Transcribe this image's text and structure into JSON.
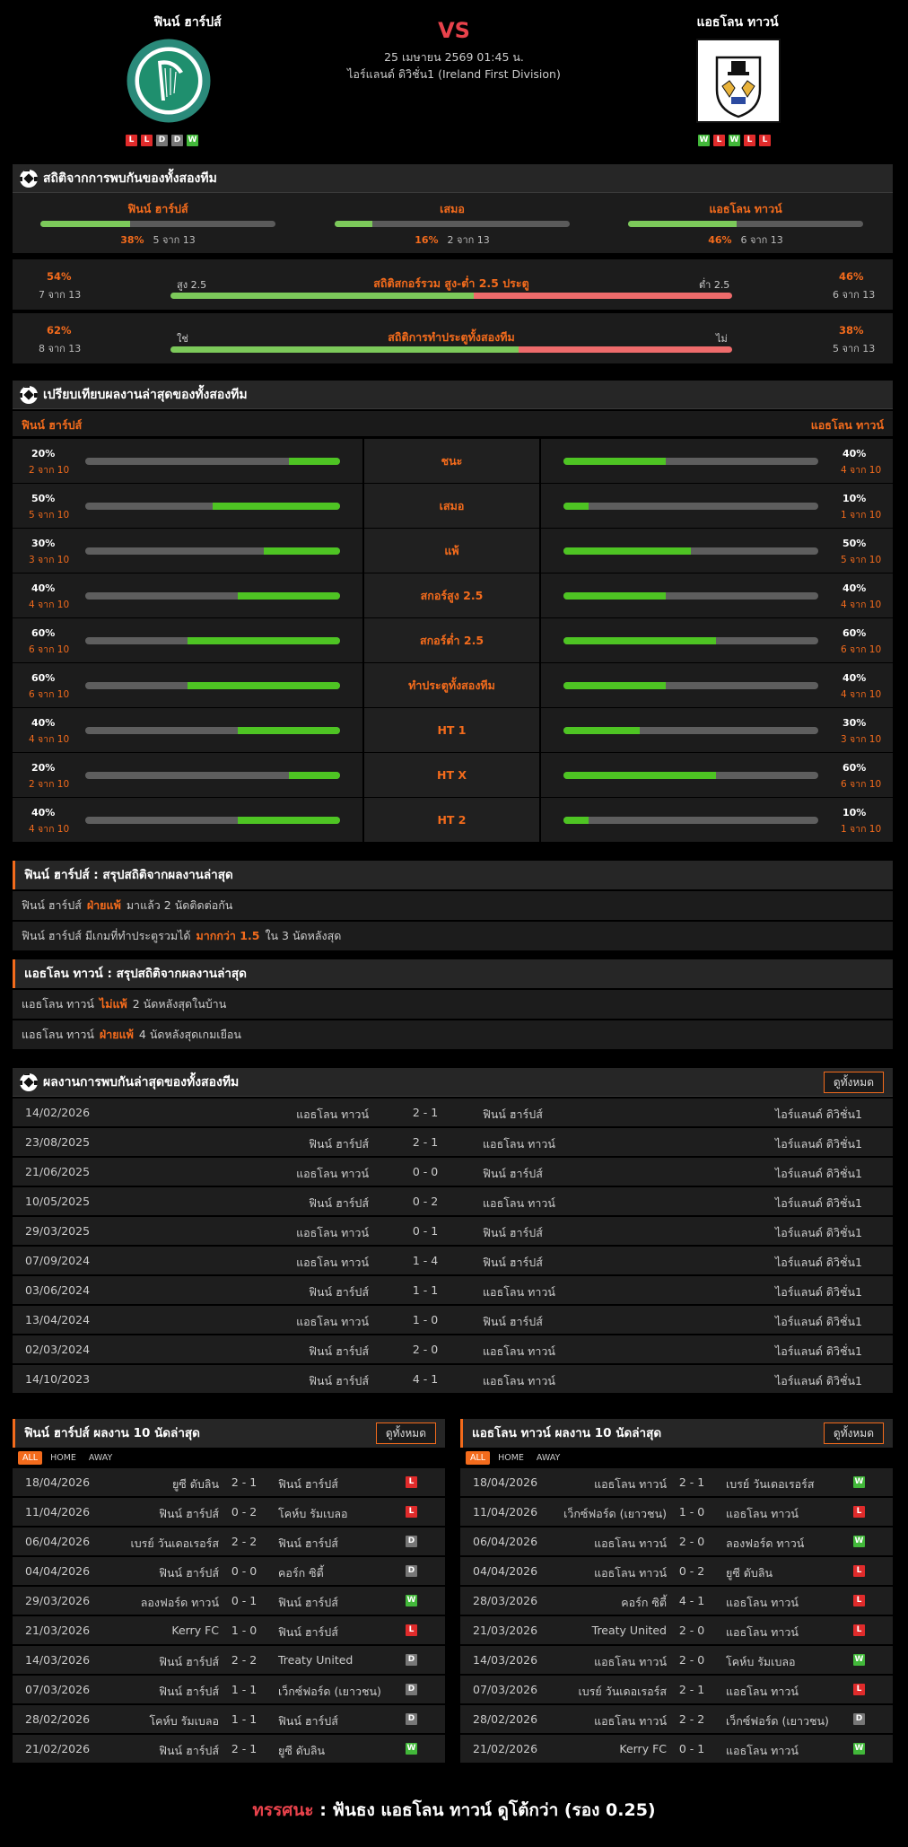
{
  "match": {
    "home_name": "ฟินน์ ฮาร์ปส์",
    "away_name": "แอธโลน ทาวน์",
    "vs": "VS",
    "date": "25 เมษายน 2569 01:45 น.",
    "league": "ไอร์แลนด์ ดิวิชั่น1 (Ireland First Division)",
    "home_form": [
      "L",
      "L",
      "D",
      "D",
      "W"
    ],
    "away_form": [
      "W",
      "L",
      "W",
      "L",
      "L"
    ],
    "home_logo_text": "FINN HARPS F.C.",
    "away_logo_text": "ATHLONE TOWN F.C."
  },
  "h2h_stats": {
    "title": "สถิติจากการพบกันของทั้งสองทีม",
    "home": {
      "label": "ฟินน์ ฮาร์ปส์",
      "pct": "38%",
      "count": "5 จาก 13",
      "value": 0.38
    },
    "draw": {
      "label": "เสมอ",
      "pct": "16%",
      "count": "2 จาก 13",
      "value": 0.16
    },
    "away": {
      "label": "แอธโลน ทาวน์",
      "pct": "46%",
      "count": "6 จาก 13",
      "value": 0.46
    },
    "ou": {
      "title": "สถิติสกอร์รวม สูง-ต่ำ 2.5 ประตู",
      "left_pct": "54%",
      "left_count": "7 จาก 13",
      "left_label": "สูง 2.5",
      "right_pct": "46%",
      "right_count": "6 จาก 13",
      "right_label": "ต่ำ 2.5",
      "value": 0.54
    },
    "btts": {
      "title": "สถิติการทำประตูทั้งสองทีม",
      "left_pct": "62%",
      "left_count": "8 จาก 13",
      "left_label": "ใช่",
      "right_pct": "38%",
      "right_count": "5 จาก 13",
      "right_label": "ไม่",
      "value": 0.62
    }
  },
  "comparison": {
    "title": "เปรียบเทียบผลงานล่าสุดของทั้งสองทีม",
    "home_name": "ฟินน์ ฮาร์ปส์",
    "away_name": "แอธโลน ทาวน์",
    "rows": [
      {
        "label": "ชนะ",
        "home_pct": "20%",
        "home_count": "2 จาก 10",
        "home_value": 0.2,
        "away_pct": "40%",
        "away_count": "4 จาก 10",
        "away_value": 0.4
      },
      {
        "label": "เสมอ",
        "home_pct": "50%",
        "home_count": "5 จาก 10",
        "home_value": 0.5,
        "away_pct": "10%",
        "away_count": "1 จาก 10",
        "away_value": 0.1
      },
      {
        "label": "แพ้",
        "home_pct": "30%",
        "home_count": "3 จาก 10",
        "home_value": 0.3,
        "away_pct": "50%",
        "away_count": "5 จาก 10",
        "away_value": 0.5
      },
      {
        "label": "สกอร์สูง 2.5",
        "home_pct": "40%",
        "home_count": "4 จาก 10",
        "home_value": 0.4,
        "away_pct": "40%",
        "away_count": "4 จาก 10",
        "away_value": 0.4
      },
      {
        "label": "สกอร์ต่ำ 2.5",
        "home_pct": "60%",
        "home_count": "6 จาก 10",
        "home_value": 0.6,
        "away_pct": "60%",
        "away_count": "6 จาก 10",
        "away_value": 0.6
      },
      {
        "label": "ทำประตูทั้งสองทีม",
        "home_pct": "60%",
        "home_count": "6 จาก 10",
        "home_value": 0.6,
        "away_pct": "40%",
        "away_count": "4 จาก 10",
        "away_value": 0.4
      },
      {
        "label": "HT 1",
        "home_pct": "40%",
        "home_count": "4 จาก 10",
        "home_value": 0.4,
        "away_pct": "30%",
        "away_count": "3 จาก 10",
        "away_value": 0.3
      },
      {
        "label": "HT X",
        "home_pct": "20%",
        "home_count": "2 จาก 10",
        "home_value": 0.2,
        "away_pct": "60%",
        "away_count": "6 จาก 10",
        "away_value": 0.6
      },
      {
        "label": "HT 2",
        "home_pct": "40%",
        "home_count": "4 จาก 10",
        "home_value": 0.4,
        "away_pct": "10%",
        "away_count": "1 จาก 10",
        "away_value": 0.1
      }
    ]
  },
  "summary_home": {
    "title": "ฟินน์ ฮาร์ปส์ : สรุปสถิติจากผลงานล่าสุด",
    "lines": [
      {
        "pre": "ฟินน์ ฮาร์ปส์",
        "hl": "ฝ่ายแพ้",
        "post": "มาแล้ว 2 นัดติดต่อกัน"
      },
      {
        "pre": "ฟินน์ ฮาร์ปส์  มีเกมที่ทำประตูรวมได้",
        "hl": "มากกว่า 1.5",
        "post": "ใน 3 นัดหลังสุด"
      }
    ]
  },
  "summary_away": {
    "title": "แอธโลน ทาวน์ : สรุปสถิติจากผลงานล่าสุด",
    "lines": [
      {
        "pre": "แอธโลน ทาวน์",
        "hl": "ไม่แพ้",
        "post": "2  นัดหลังสุดในบ้าน"
      },
      {
        "pre": "แอธโลน ทาวน์",
        "hl": "ฝ่ายแพ้",
        "post": "4  นัดหลังสุดเกมเยือน"
      }
    ]
  },
  "h2h_results": {
    "title": "ผลงานการพบกันล่าสุดของทั้งสองทีม",
    "see_all": "ดูทั้งหมด",
    "rows": [
      {
        "date": "14/02/2026",
        "home": "แอธโลน ทาวน์",
        "score": "2 - 1",
        "away": "ฟินน์ ฮาร์ปส์",
        "league": "ไอร์แลนด์ ดิวิชั่น1"
      },
      {
        "date": "23/08/2025",
        "home": "ฟินน์ ฮาร์ปส์",
        "score": "2 - 1",
        "away": "แอธโลน ทาวน์",
        "league": "ไอร์แลนด์ ดิวิชั่น1"
      },
      {
        "date": "21/06/2025",
        "home": "แอธโลน ทาวน์",
        "score": "0 - 0",
        "away": "ฟินน์ ฮาร์ปส์",
        "league": "ไอร์แลนด์ ดิวิชั่น1"
      },
      {
        "date": "10/05/2025",
        "home": "ฟินน์ ฮาร์ปส์",
        "score": "0 - 2",
        "away": "แอธโลน ทาวน์",
        "league": "ไอร์แลนด์ ดิวิชั่น1"
      },
      {
        "date": "29/03/2025",
        "home": "แอธโลน ทาวน์",
        "score": "0 - 1",
        "away": "ฟินน์ ฮาร์ปส์",
        "league": "ไอร์แลนด์ ดิวิชั่น1"
      },
      {
        "date": "07/09/2024",
        "home": "แอธโลน ทาวน์",
        "score": "1 - 4",
        "away": "ฟินน์ ฮาร์ปส์",
        "league": "ไอร์แลนด์ ดิวิชั่น1"
      },
      {
        "date": "03/06/2024",
        "home": "ฟินน์ ฮาร์ปส์",
        "score": "1 - 1",
        "away": "แอธโลน ทาวน์",
        "league": "ไอร์แลนด์ ดิวิชั่น1"
      },
      {
        "date": "13/04/2024",
        "home": "แอธโลน ทาวน์",
        "score": "1 - 0",
        "away": "ฟินน์ ฮาร์ปส์",
        "league": "ไอร์แลนด์ ดิวิชั่น1"
      },
      {
        "date": "02/03/2024",
        "home": "ฟินน์ ฮาร์ปส์",
        "score": "2 - 0",
        "away": "แอธโลน ทาวน์",
        "league": "ไอร์แลนด์ ดิวิชั่น1"
      },
      {
        "date": "14/10/2023",
        "home": "ฟินน์ ฮาร์ปส์",
        "score": "4 - 1",
        "away": "แอธโลน ทาวน์",
        "league": "ไอร์แลนด์ ดิวิชั่น1"
      }
    ]
  },
  "last10_home": {
    "title": "ฟินน์ ฮาร์ปส์ ผลงาน 10 นัดล่าสุด",
    "see_all": "ดูทั้งหมด",
    "tabs": [
      "ALL",
      "HOME",
      "AWAY"
    ],
    "rows": [
      {
        "date": "18/04/2026",
        "home": "ยูซี ดับลิน",
        "score": "2 - 1",
        "away": "ฟินน์ ฮาร์ปส์",
        "res": "L"
      },
      {
        "date": "11/04/2026",
        "home": "ฟินน์ ฮาร์ปส์",
        "score": "0 - 2",
        "away": "โคห์บ รัมเบลอ",
        "res": "L"
      },
      {
        "date": "06/04/2026",
        "home": "เบรย์ วันเดอเรอร์ส",
        "score": "2 - 2",
        "away": "ฟินน์ ฮาร์ปส์",
        "res": "D"
      },
      {
        "date": "04/04/2026",
        "home": "ฟินน์ ฮาร์ปส์",
        "score": "0 - 0",
        "away": "คอร์ก ซิตี้",
        "res": "D"
      },
      {
        "date": "29/03/2026",
        "home": "ลองฟอร์ด ทาวน์",
        "score": "0 - 1",
        "away": "ฟินน์ ฮาร์ปส์",
        "res": "W"
      },
      {
        "date": "21/03/2026",
        "home": "Kerry FC",
        "score": "1 - 0",
        "away": "ฟินน์ ฮาร์ปส์",
        "res": "L"
      },
      {
        "date": "14/03/2026",
        "home": "ฟินน์ ฮาร์ปส์",
        "score": "2 - 2",
        "away": "Treaty United",
        "res": "D"
      },
      {
        "date": "07/03/2026",
        "home": "ฟินน์ ฮาร์ปส์",
        "score": "1 - 1",
        "away": "เว็กซ์ฟอร์ด (เยาวชน)",
        "res": "D"
      },
      {
        "date": "28/02/2026",
        "home": "โคห์บ รัมเบลอ",
        "score": "1 - 1",
        "away": "ฟินน์ ฮาร์ปส์",
        "res": "D"
      },
      {
        "date": "21/02/2026",
        "home": "ฟินน์ ฮาร์ปส์",
        "score": "2 - 1",
        "away": "ยูซี ดับลิน",
        "res": "W"
      }
    ]
  },
  "last10_away": {
    "title": "แอธโลน ทาวน์ ผลงาน 10 นัดล่าสุด",
    "see_all": "ดูทั้งหมด",
    "tabs": [
      "ALL",
      "HOME",
      "AWAY"
    ],
    "rows": [
      {
        "date": "18/04/2026",
        "home": "แอธโลน ทาวน์",
        "score": "2 - 1",
        "away": "เบรย์ วันเดอเรอร์ส",
        "res": "W"
      },
      {
        "date": "11/04/2026",
        "home": "เว็กซ์ฟอร์ด (เยาวชน)",
        "score": "1 - 0",
        "away": "แอธโลน ทาวน์",
        "res": "L"
      },
      {
        "date": "06/04/2026",
        "home": "แอธโลน ทาวน์",
        "score": "2 - 0",
        "away": "ลองฟอร์ด ทาวน์",
        "res": "W"
      },
      {
        "date": "04/04/2026",
        "home": "แอธโลน ทาวน์",
        "score": "0 - 2",
        "away": "ยูซี ดับลิน",
        "res": "L"
      },
      {
        "date": "28/03/2026",
        "home": "คอร์ก ซิตี้",
        "score": "4 - 1",
        "away": "แอธโลน ทาวน์",
        "res": "L"
      },
      {
        "date": "21/03/2026",
        "home": "Treaty United",
        "score": "2 - 0",
        "away": "แอธโลน ทาวน์",
        "res": "L"
      },
      {
        "date": "14/03/2026",
        "home": "แอธโลน ทาวน์",
        "score": "2 - 0",
        "away": "โคห์บ รัมเบลอ",
        "res": "W"
      },
      {
        "date": "07/03/2026",
        "home": "เบรย์ วันเดอเรอร์ส",
        "score": "2 - 1",
        "away": "แอธโลน ทาวน์",
        "res": "L"
      },
      {
        "date": "28/02/2026",
        "home": "แอธโลน ทาวน์",
        "score": "2 - 2",
        "away": "เว็กซ์ฟอร์ด (เยาวชน)",
        "res": "D"
      },
      {
        "date": "21/02/2026",
        "home": "Kerry FC",
        "score": "0 - 1",
        "away": "แอธโลน ทาวน์",
        "res": "W"
      }
    ]
  },
  "prediction": {
    "label": "ทรรศนะ",
    "separator": ":",
    "text": "ฟันธง แอธโลน ทาวน์ ดูโต้กว่า (รอง 0.25)"
  },
  "colors": {
    "accent": "#f36b1c",
    "win": "#42b83a",
    "loss": "#e02b2b",
    "draw": "#777777",
    "bar_green": "#4ec423",
    "bar_red": "#ee6b6b"
  }
}
